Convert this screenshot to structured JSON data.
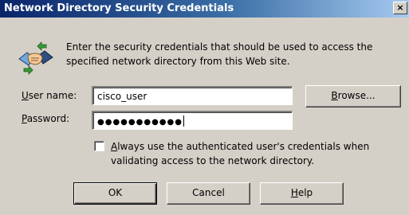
{
  "window": {
    "title": "Network Directory Security Credentials",
    "close_glyph": "×"
  },
  "icon": "handshake-icon",
  "description": "Enter the security credentials that should be used to access the\nspecified network directory from this Web site.",
  "username": {
    "label_mnemonic": "U",
    "label_rest": "ser name:",
    "value": "cisco_user"
  },
  "password": {
    "label_mnemonic": "P",
    "label_rest": "assword:",
    "value_masked": "●●●●●●●●●●●"
  },
  "browse_button": {
    "mnemonic": "B",
    "rest": "rowse..."
  },
  "checkbox": {
    "checked": false,
    "label_mnemonic": "A",
    "label_rest": "lways use the authenticated user's credentials when\nvalidating access to the network directory."
  },
  "buttons": {
    "ok": "OK",
    "cancel": "Cancel",
    "help_mnemonic": "H",
    "help_rest": "elp"
  },
  "colors": {
    "title_gradient_start": "#0a246a",
    "title_gradient_end": "#a6caf0",
    "dialog_face": "#d4d0c8"
  }
}
